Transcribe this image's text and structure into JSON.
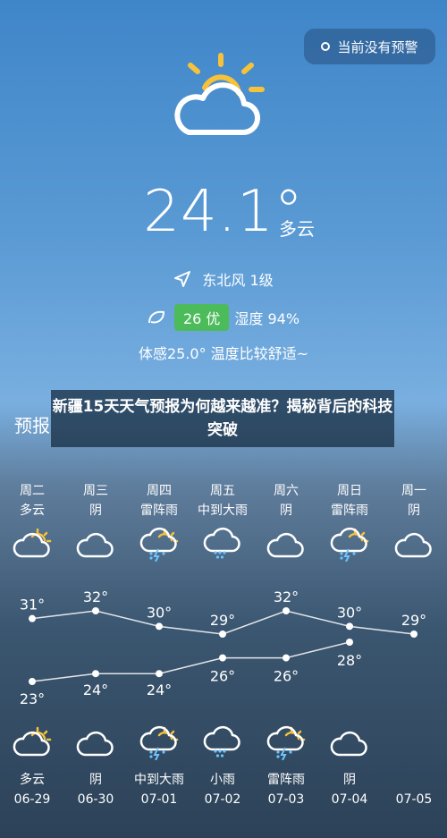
{
  "alert": {
    "label": "当前没有预警"
  },
  "current": {
    "icon": "partly-cloudy-icon",
    "temperature": "24.1°",
    "condition": "多云",
    "wind": "东北风 1级",
    "aqi": "26 优",
    "humidity": "湿度 94%",
    "feels_like": "体感25.0° 温度比较舒适~"
  },
  "section": {
    "title": "预报"
  },
  "headline": {
    "text": "新疆15天天气预报为何越来越准？揭秘背后的科技突破"
  },
  "forecast": [
    {
      "weekday": "周二",
      "day_cond": "多云",
      "day_icon": "partly-cloudy-icon",
      "high": "31°",
      "low": "23°",
      "night_icon": "partly-cloudy-icon",
      "night_cond": "多云",
      "date": "06-29"
    },
    {
      "weekday": "周三",
      "day_cond": "阴",
      "day_icon": "cloud-icon",
      "high": "32°",
      "low": "24°",
      "night_icon": "cloud-icon",
      "night_cond": "阴",
      "date": "06-30"
    },
    {
      "weekday": "周四",
      "day_cond": "雷阵雨",
      "day_icon": "thunderstorm-icon",
      "high": "30°",
      "low": "24°",
      "night_icon": "thunderstorm-icon",
      "night_cond": "中到大雨",
      "date": "07-01"
    },
    {
      "weekday": "周五",
      "day_cond": "中到大雨",
      "day_icon": "rain-icon",
      "high": "29°",
      "low": "26°",
      "night_icon": "rain-icon",
      "night_cond": "小雨",
      "date": "07-02"
    },
    {
      "weekday": "周六",
      "day_cond": "阴",
      "day_icon": "cloud-icon",
      "high": "32°",
      "low": "26°",
      "night_icon": "thunderstorm-icon",
      "night_cond": "雷阵雨",
      "date": "07-03"
    },
    {
      "weekday": "周日",
      "day_cond": "雷阵雨",
      "day_icon": "thunderstorm-icon",
      "high": "30°",
      "low": "28°",
      "night_icon": "cloud-icon",
      "night_cond": "阴",
      "date": "07-04"
    },
    {
      "weekday": "周一",
      "day_cond": "阴",
      "day_icon": "cloud-icon",
      "high": "29°",
      "low": "",
      "night_icon": "",
      "night_cond": "",
      "date": "07-05"
    }
  ],
  "chart_data": {
    "type": "line",
    "categories": [
      "06-29",
      "06-30",
      "07-01",
      "07-02",
      "07-03",
      "07-04",
      "07-05"
    ],
    "series": [
      {
        "values": [
          31,
          32,
          30,
          29,
          32,
          30,
          29
        ]
      },
      {
        "values": [
          23,
          24,
          24,
          26,
          26,
          28,
          null
        ]
      }
    ]
  }
}
